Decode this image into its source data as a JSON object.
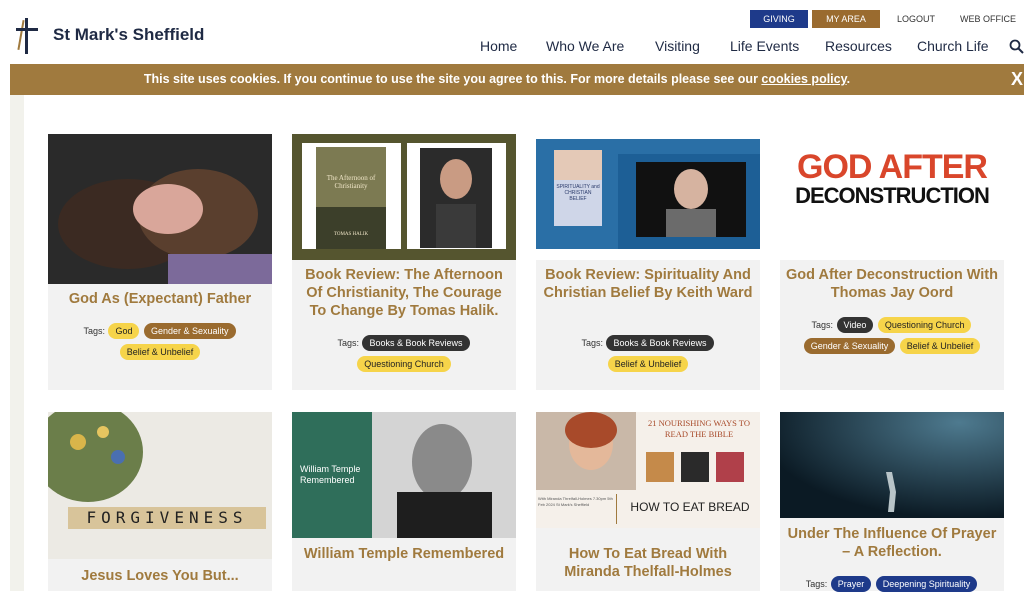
{
  "site": {
    "title": "St Mark's Sheffield"
  },
  "util_links": [
    "GIVING",
    "MY AREA",
    "LOGOUT",
    "WEB OFFICE"
  ],
  "nav": [
    "Home",
    "Who We Are",
    "Visiting",
    "Life Events",
    "Resources",
    "Church Life"
  ],
  "cookie": {
    "text": "This site uses cookies. If you continue to use the site you agree to this. For more details please see our ",
    "link": "cookies policy",
    "after": ".",
    "close": "X"
  },
  "colors": {
    "accent": "#a07a3e",
    "navy": "#1e3a8a",
    "tag_yellow": "#f6d44a",
    "tag_brown": "#9a6b2f"
  },
  "tags_label": "Tags:",
  "cards": [
    {
      "title": "God As (Expectant) Father",
      "tags": [
        [
          "God",
          "yellow"
        ],
        [
          "Gender & Sexuality",
          "brown"
        ],
        [
          "Belief & Unbelief",
          "yellow"
        ]
      ]
    },
    {
      "title": "Book Review: The Afternoon Of Christianity, The Courage To Change By Tomas Halik.",
      "tags": [
        [
          "Books & Book Reviews",
          "dark"
        ],
        [
          "Questioning Church",
          "yellow"
        ]
      ]
    },
    {
      "title": "Book Review: Spirituality And Christian Belief By Keith Ward",
      "tags": [
        [
          "Books & Book Reviews",
          "dark"
        ],
        [
          "Belief & Unbelief",
          "yellow"
        ]
      ]
    },
    {
      "title": "God After Deconstruction With Thomas Jay Oord",
      "tags": [
        [
          "Video",
          "dark"
        ],
        [
          "Questioning Church",
          "yellow"
        ],
        [
          "Gender & Sexuality",
          "brown"
        ],
        [
          "Belief & Unbelief",
          "yellow"
        ]
      ]
    },
    {
      "title": "Jesus Loves You But...",
      "tags": []
    },
    {
      "title": "William Temple Remembered",
      "tags": []
    },
    {
      "title": "How To Eat Bread With Miranda Thelfall-Holmes",
      "tags": []
    },
    {
      "title": "Under The Influence Of Prayer – A Reflection.",
      "tags": [
        [
          "Prayer",
          "blue"
        ],
        [
          "Deepening Spirituality",
          "blue"
        ]
      ]
    }
  ],
  "image_text": {
    "book1_title": "The Afternoon of Christianity",
    "book1_author": "TOMAS HALIK",
    "book2_title": "SPIRITUALITY and CHRISTIAN BELIEF",
    "gad_line1": "GOD AFTER",
    "gad_line2": "DECONSTRUCTION",
    "forgiveness": "FORGIVENESS",
    "wtr_caption": "William Temple Remembered",
    "bread_top": "21 NOURISHING WAYS TO READ THE BIBLE",
    "bread_bottom": "HOW TO EAT BREAD",
    "bread_meta": "With Miranda Threlfall-Holmes 7.30pm 5th Feb 2024 St Mark's Sheffield"
  }
}
